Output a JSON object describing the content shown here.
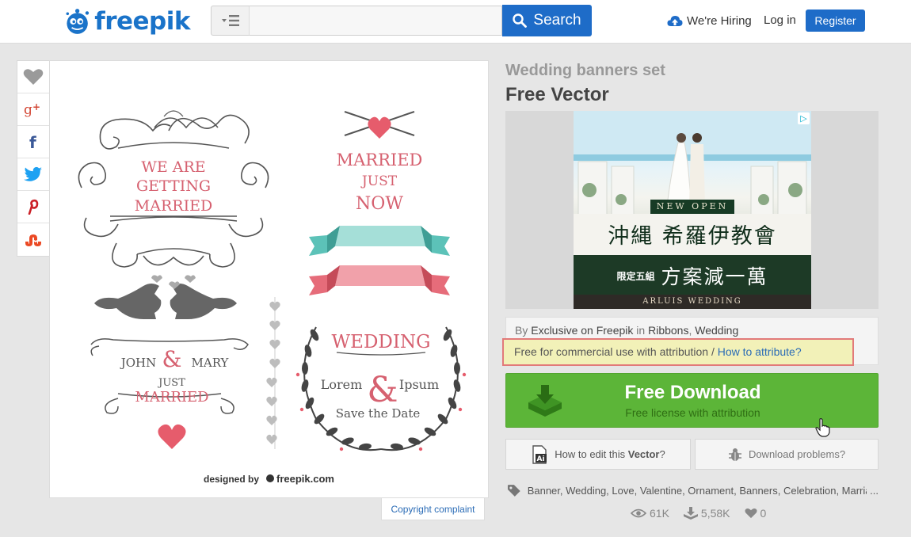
{
  "header": {
    "logo_text": "freepik",
    "search_placeholder": "",
    "search_label": "Search",
    "hiring_label": "We're Hiring",
    "login_label": "Log in",
    "register_label": "Register"
  },
  "share": [
    "heart-icon",
    "google-plus-icon",
    "facebook-icon",
    "twitter-icon",
    "pinterest-icon",
    "stumbleupon-icon"
  ],
  "preview": {
    "getting_married": [
      "WE ARE",
      "GETTING",
      "MARRIED"
    ],
    "married_just_now": [
      "MARRIED",
      "JUST",
      "NOW"
    ],
    "names": {
      "left": "JOHN",
      "amp": "&",
      "right": "MARY",
      "just": "JUST",
      "married": "MARRIED"
    },
    "wreath": {
      "title": "WEDDING",
      "left": "Lorem",
      "amp": "&",
      "right": "Ipsum",
      "sub": "Save the Date"
    },
    "designed_by": "designed by",
    "brand": "freepik.com",
    "colors": {
      "pink": "#d66170",
      "dark": "#555555",
      "teal": "#5cc2b8",
      "heart": "#e65c6c"
    }
  },
  "copyright_label": "Copyright complaint",
  "resource": {
    "title": "Wedding banners set",
    "type": "Free Vector",
    "by_prefix": "By",
    "author": "Exclusive on Freepik",
    "in_label": "in",
    "category_1": "Ribbons",
    "category_sep": ",",
    "category_2": "Wedding",
    "license_text": "Free for commercial use with attribution /",
    "license_link": "How to attribute?"
  },
  "ad": {
    "new_open": "NEW OPEN",
    "line1": "沖縄 希羅伊教會",
    "line2_small": "限定五組",
    "line2_big": "方案減一萬",
    "brand": "ARLUIS WEDDING",
    "badge": "▷"
  },
  "download": {
    "title": "Free Download",
    "subtitle": "Free license with attribution",
    "color": "#5cb538"
  },
  "help": {
    "edit_prefix": "How to edit this",
    "edit_bold": "Vector",
    "edit_suffix": "?",
    "problems": "Download problems?"
  },
  "tags": {
    "list": "Banner, Wedding, Love, Valentine, Ornament, Banners, Celebration, Marriage",
    "more": "..."
  },
  "stats": {
    "views": "61K",
    "downloads": "5,58K",
    "likes": "0"
  }
}
